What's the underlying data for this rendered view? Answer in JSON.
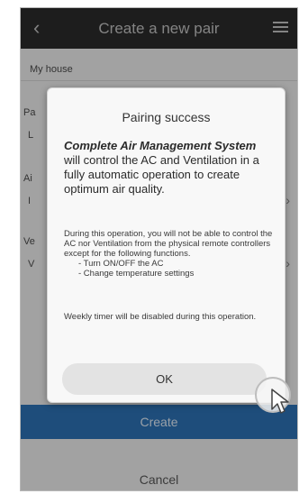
{
  "header": {
    "title": "Create a new pair",
    "back_glyph": "‹",
    "menu_icon": "hamburger-icon"
  },
  "form": {
    "house_label": "My house",
    "side_labels": [
      "Pa",
      "Ai",
      "Ve"
    ],
    "side_values": [
      "L",
      "I",
      "V"
    ],
    "create_label": "Create",
    "cancel_label": "Cancel"
  },
  "dialog": {
    "title": "Pairing success",
    "lead_bold": "Complete Air Management System",
    "lead_rest": " will control the AC and Ventilation in a fully automatic operation to create optimum air quality.",
    "note": "During this operation, you will not be able to control the AC nor Ventilation from the physical remote controllers except for the following functions.",
    "note_items": [
      "- Turn ON/OFF the AC",
      "- Change temperature settings"
    ],
    "timer_note": "Weekly timer will be disabled during this operation.",
    "ok_label": "OK"
  },
  "colors": {
    "header_bg": "#2a2a2a",
    "create_bg": "#2b6fb1",
    "dialog_bg": "#f8f8f8"
  }
}
